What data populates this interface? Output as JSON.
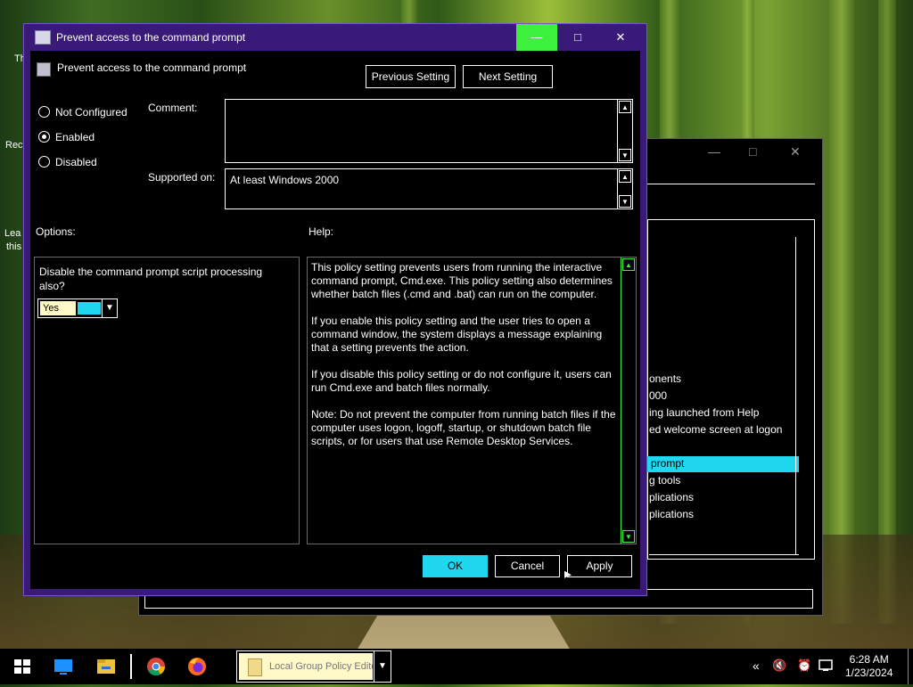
{
  "dialog": {
    "window_title": "Prevent access to the command prompt",
    "setting_title": "Prevent access to the command prompt",
    "prev_btn": "Previous Setting",
    "next_btn": "Next Setting",
    "radios": [
      "Not Configured",
      "Enabled",
      "Disabled"
    ],
    "selected_radio": "Enabled",
    "comment_label": "Comment:",
    "comment_value": "",
    "supported_label": "Supported on:",
    "supported_value": "At least Windows 2000",
    "options_label": "Options:",
    "help_label": "Help:",
    "option_question": "Disable the command prompt script processing also?",
    "option_value": "Yes",
    "help_paragraphs": [
      "This policy setting prevents users from running the interactive command prompt, Cmd.exe.  This policy setting also determines whether batch files (.cmd and .bat) can run on the computer.",
      "If you enable this policy setting and the user tries to open a command window, the system displays a message explaining that a setting prevents the action.",
      "If you disable this policy setting or do not configure it, users can run Cmd.exe and batch files normally.",
      "Note: Do not prevent the computer from running batch files if the computer uses logon, logoff, startup, or shutdown batch file scripts, or for users that use Remote Desktop Services."
    ],
    "ok_btn": "OK",
    "cancel_btn": "Cancel",
    "apply_btn": "Apply",
    "controls": {
      "minimize": "—",
      "maximize": "□",
      "close": "✕"
    }
  },
  "background_window": {
    "controls": {
      "minimize": "—",
      "maximize": "□",
      "close": "✕"
    },
    "rows": [
      "onents",
      "000",
      "ing launched from Help",
      "ed welcome screen at logon",
      "prompt",
      "g tools",
      "plications",
      "plications"
    ],
    "selected_row": "prompt"
  },
  "desktop_fragments": [
    "Th",
    "Rec",
    "Lea",
    "this"
  ],
  "taskbar": {
    "task_label": "Local Group Policy Editor",
    "time": "6:28 AM",
    "date": "1/23/2024",
    "icons": [
      "windows-start-icon",
      "desktop-icon",
      "file-explorer-icon",
      "chrome-icon",
      "firefox-icon"
    ]
  },
  "colors": {
    "accent": "#1fd8f0",
    "title_bar": "#3a1a78",
    "minimize_highlight": "#3ef03e"
  }
}
